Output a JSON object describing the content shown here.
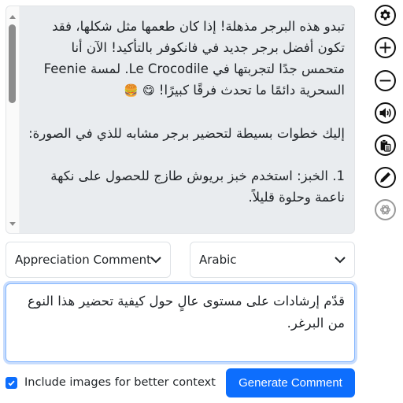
{
  "comment_panel": {
    "paragraphs": [
      "تبدو هذه البرجر مذهلة! إذا كان طعمها مثل شكلها، فقد تكون أفضل برجر جديد في فانكوفر بالتأكيد! الآن أنا متحمس جدًا لتجربتها في Le Crocodile. لمسة Feenie السحرية دائمًا ما تحدث فرقًا كبيرًا!",
      "إليك خطوات بسيطة لتحضير برجر مشابه للذي في الصورة:",
      "1. الخبز: استخدم خبز بريوش طازج للحصول على نكهة ناعمة وحلوة قليلاً."
    ],
    "emojis": [
      "😋",
      "🍔"
    ]
  },
  "toolbar": {
    "icons": [
      {
        "name": "settings-icon",
        "label": "Settings"
      },
      {
        "name": "zoom-in-icon",
        "label": "Increase font"
      },
      {
        "name": "zoom-out-icon",
        "label": "Decrease font"
      },
      {
        "name": "speaker-icon",
        "label": "Read aloud"
      },
      {
        "name": "clipboard-icon",
        "label": "Copy"
      },
      {
        "name": "pencil-icon",
        "label": "Edit"
      },
      {
        "name": "openai-icon",
        "label": "OpenAI"
      }
    ]
  },
  "comment_type_select": {
    "selected": "Appreciation Comment"
  },
  "language_select": {
    "selected": "Arabic"
  },
  "prompt": {
    "value": "قدّم إرشادات على مستوى عالٍ حول كيفية تحضير هذا النوع من البرغر."
  },
  "include_images": {
    "label": "Include images for better context",
    "checked": true
  },
  "generate_button": {
    "label": "Generate Comment"
  },
  "colors": {
    "accent": "#0d6efd",
    "panel_bg": "#e9ecef",
    "focus_ring": "#86b7fe"
  }
}
